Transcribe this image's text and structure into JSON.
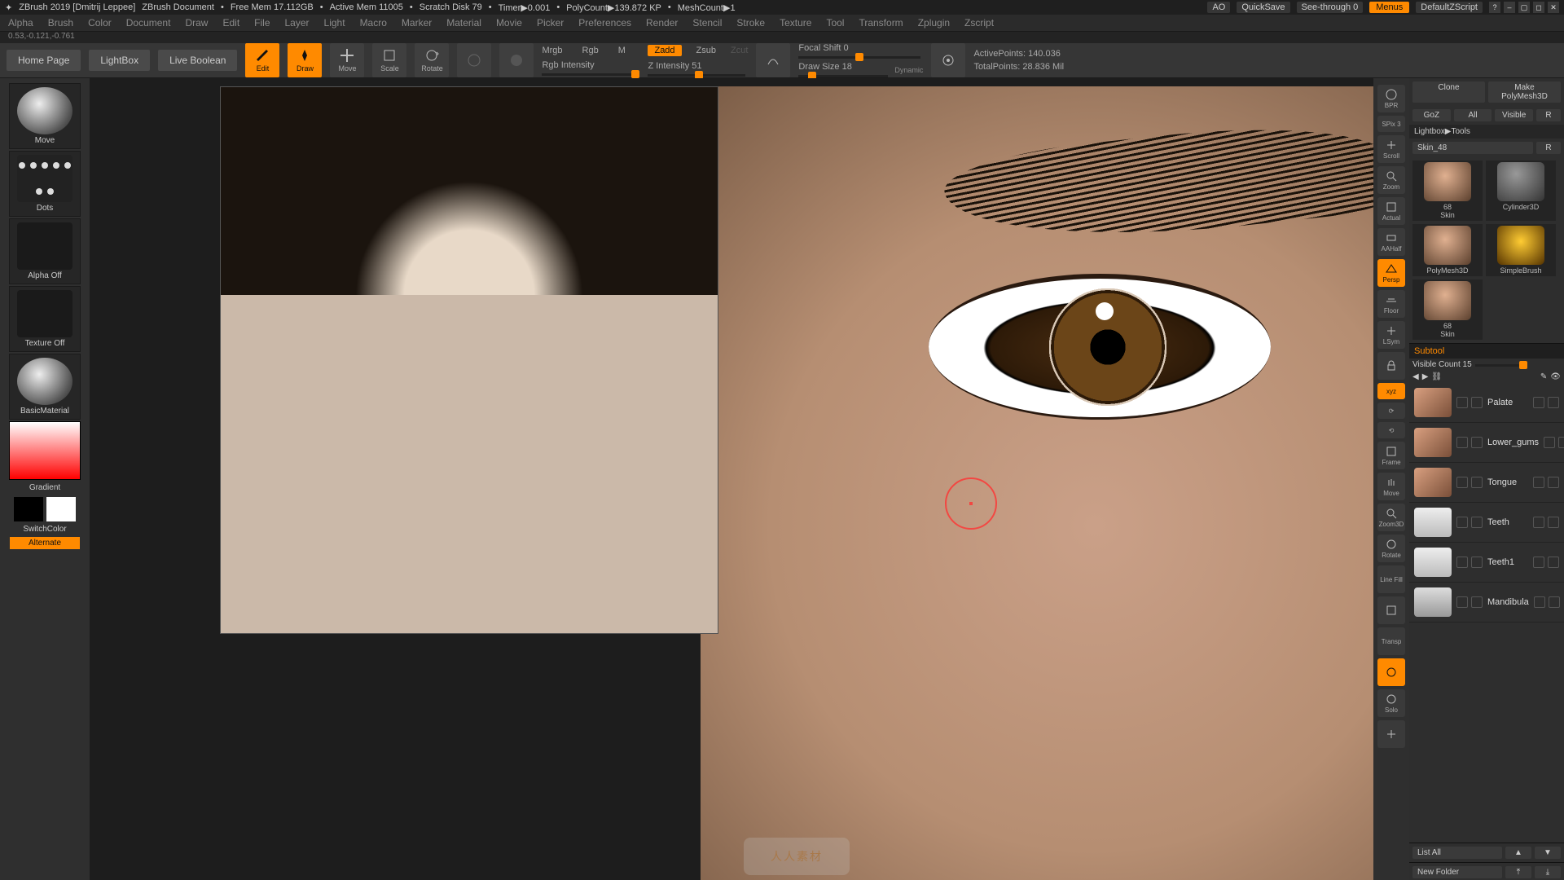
{
  "title": {
    "app": "ZBrush 2019 [Dmitrij Leppee]",
    "doc": "ZBrush Document",
    "freemem": "Free Mem 17.112GB",
    "activemem": "Active Mem 11005",
    "scratch": "Scratch Disk 79",
    "timer": "Timer▶0.001",
    "polycount": "PolyCount▶139.872 KP",
    "meshcount": "MeshCount▶1",
    "ao": "AO",
    "quicksave": "QuickSave",
    "seethrough": "See-through  0",
    "menus": "Menus",
    "defaultscript": "DefaultZScript"
  },
  "menubar": [
    "Alpha",
    "Brush",
    "Color",
    "Document",
    "Draw",
    "Edit",
    "File",
    "Layer",
    "Light",
    "Macro",
    "Marker",
    "Material",
    "Movie",
    "Picker",
    "Preferences",
    "Render",
    "Stencil",
    "Stroke",
    "Texture",
    "Tool",
    "Transform",
    "Zplugin",
    "Zscript"
  ],
  "coords": "0.53,-0.121,-0.761",
  "toolbar": {
    "home": "Home Page",
    "lightbox": "LightBox",
    "livebool": "Live Boolean",
    "edit": "Edit",
    "draw": "Draw",
    "move": "Move",
    "scale": "Scale",
    "rotate": "Rotate",
    "mrgb": "Mrgb",
    "rgb": "Rgb",
    "m": "M",
    "rgbint": "Rgb Intensity",
    "zadd": "Zadd",
    "zsub": "Zsub",
    "zcut": "Zcut",
    "zint": "Z Intensity 51",
    "focal": "Focal Shift 0",
    "drawsize": "Draw Size 18",
    "dynamic": "Dynamic",
    "activepts": "ActivePoints: 140.036",
    "totalpts": "TotalPoints: 28.836 Mil"
  },
  "left": {
    "move": "Move",
    "dots": "Dots",
    "alphaoff": "Alpha Off",
    "texoff": "Texture Off",
    "basicmat": "BasicMaterial",
    "gradient": "Gradient",
    "switch": "SwitchColor",
    "alternate": "Alternate"
  },
  "strip": {
    "bpr": "BPR",
    "spix": "SPix 3",
    "scroll": "Scroll",
    "zoom": "Zoom",
    "actual": "Actual",
    "aahalf": "AAHalf",
    "persp": "Persp",
    "floor": "Floor",
    "lsym": "LSym",
    "xyz": "xyz",
    "frame": "Frame",
    "move": "Move",
    "zoom3d": "Zoom3D",
    "rotate": "Rotate",
    "linefill": "Line Fill",
    "transp": "Transp",
    "solo": "Solo"
  },
  "right": {
    "clone": "Clone",
    "polymesh": "Make PolyMesh3D",
    "goz": "GoZ",
    "all": "All",
    "visible": "Visible",
    "r": "R",
    "crumb": "Lightbox▶Tools",
    "skinslider": "Skin_48",
    "tools": [
      {
        "name": "Skin",
        "badge": "68"
      },
      {
        "name": "Cylinder3D",
        "badge": ""
      },
      {
        "name": "PolyMesh3D",
        "badge": ""
      },
      {
        "name": "SimpleBrush",
        "badge": ""
      },
      {
        "name": "Skin",
        "badge": "68"
      }
    ],
    "subtool_h": "Subtool",
    "visible_count": "Visible Count 15",
    "subtools": [
      {
        "name": "Palate",
        "cls": ""
      },
      {
        "name": "Lower_gums",
        "cls": ""
      },
      {
        "name": "Tongue",
        "cls": ""
      },
      {
        "name": "Teeth",
        "cls": "teeth"
      },
      {
        "name": "Teeth1",
        "cls": "teeth"
      },
      {
        "name": "Mandibula",
        "cls": "bone"
      }
    ],
    "listall": "List All",
    "newfolder": "New Folder"
  },
  "watermark": "人人素材"
}
